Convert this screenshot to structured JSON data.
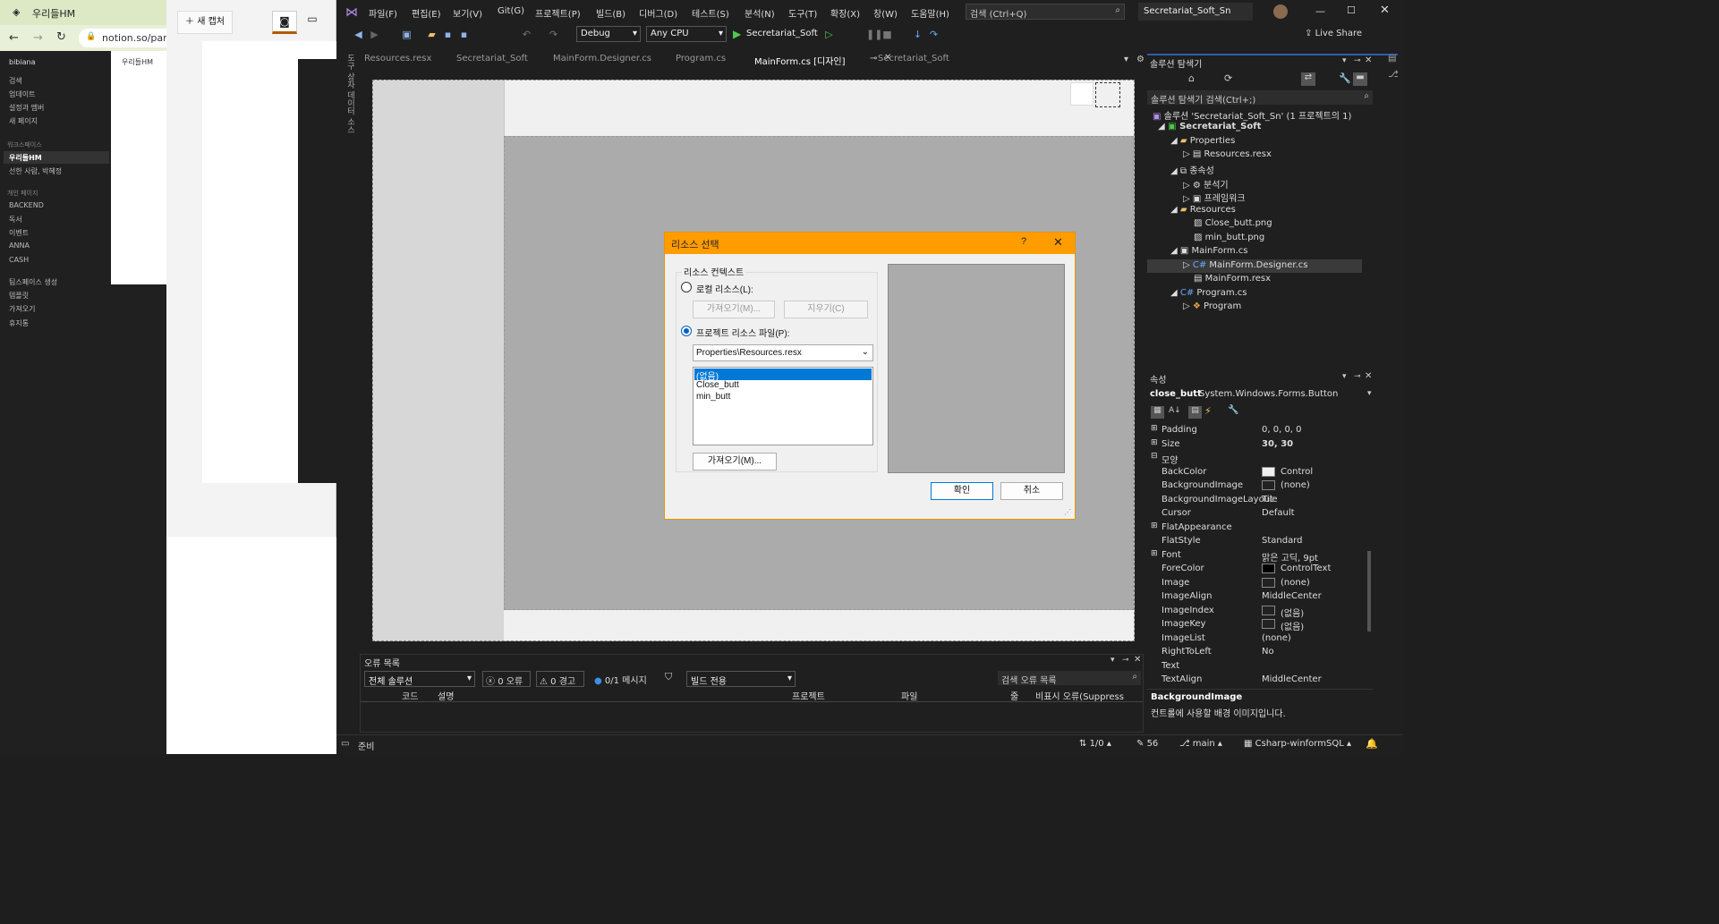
{
  "chrome": {
    "tab_title": "우리들HM",
    "address": "notion.so/par",
    "notion": {
      "workspace": "bibiana",
      "nav": [
        "검색",
        "업데이트",
        "설정과 멤버",
        "새 페이지"
      ],
      "section_workspace": "워크스페이스",
      "workspace_items": [
        "우리들HM",
        "선한 사람, 박혜정"
      ],
      "section_private": "개인 페이지",
      "private_items": [
        "BACKEND",
        "독서",
        "이벤트",
        "ANNA",
        "CASH"
      ],
      "bottom_items": [
        "팀스페이스 생성",
        "템플릿",
        "가져오기",
        "휴지통"
      ],
      "page_tab": "우리들HM"
    }
  },
  "capture": {
    "new_capture": "새 캡처"
  },
  "vs": {
    "menu": [
      "파일(F)",
      "편집(E)",
      "보기(V)",
      "Git(G)",
      "프로젝트(P)",
      "빌드(B)",
      "디버그(D)",
      "테스트(S)",
      "분석(N)",
      "도구(T)",
      "확장(X)",
      "창(W)",
      "도움말(H)"
    ],
    "search_placeholder": "검색 (Ctrl+Q)",
    "solution_name": "Secretariat_Soft_Sn",
    "live_share": "Live Share",
    "config": "Debug",
    "platform": "Any CPU",
    "run_target": "Secretariat_Soft",
    "doc_tabs": [
      "Resources.resx",
      "Secretariat_Soft",
      "MainForm.Designer.cs",
      "Program.cs",
      "MainForm.cs [디자인]",
      "Secretariat_Soft"
    ],
    "side_toolbox": "도구 상자  데이터 소스",
    "dialog": {
      "title": "리소스 선택",
      "help": "?",
      "group_label": "리소스 컨텍스트",
      "local_radio": "로컬 리소스(L):",
      "import_btn_disabled": "가져오기(M)...",
      "clear_btn": "지우기(C)",
      "project_radio": "프로젝트 리소스 파일(P):",
      "resx_file": "Properties\\Resources.resx",
      "list": [
        "(없음)",
        "Close_butt",
        "min_butt"
      ],
      "import_btn": "가져오기(M)...",
      "ok": "확인",
      "cancel": "취소"
    },
    "error_list": {
      "title": "오류 목록",
      "scope": "전체 솔루션",
      "errors": "0 오류",
      "warnings": "0 경고",
      "messages": "0/1 메시지",
      "build_filter": "빌드 전용",
      "search": "검색 오류 목록",
      "columns": [
        "코드",
        "설명",
        "프로젝트",
        "파일",
        "줄",
        "비표시 오류(Suppress"
      ]
    },
    "solution_explorer": {
      "title": "솔루션 탐색기",
      "search": "솔루션 탐색기 검색(Ctrl+;)",
      "items": [
        "솔루션 'Secretariat_Soft_Sn' (1 프로젝트의 1)",
        "Secretariat_Soft",
        "Properties",
        "Resources.resx",
        "종속성",
        "분석기",
        "프레임워크",
        "Resources",
        "Close_butt.png",
        "min_butt.png",
        "MainForm.cs",
        "MainForm.Designer.cs",
        "MainForm.resx",
        "Program.cs",
        "Program"
      ]
    },
    "properties": {
      "title": "속성",
      "object": "close_butt",
      "object_type": "System.Windows.Forms.Button",
      "rows": [
        {
          "name": "Padding",
          "value": "0, 0, 0, 0"
        },
        {
          "name": "Size",
          "value": "30, 30"
        },
        {
          "name": "모양",
          "value": ""
        },
        {
          "name": "BackColor",
          "value": "Control"
        },
        {
          "name": "BackgroundImage",
          "value": "(none)"
        },
        {
          "name": "BackgroundImageLayout",
          "value": "Tile"
        },
        {
          "name": "Cursor",
          "value": "Default"
        },
        {
          "name": "FlatAppearance",
          "value": ""
        },
        {
          "name": "FlatStyle",
          "value": "Standard"
        },
        {
          "name": "Font",
          "value": "맑은 고딕, 9pt"
        },
        {
          "name": "ForeColor",
          "value": "ControlText"
        },
        {
          "name": "Image",
          "value": "(none)"
        },
        {
          "name": "ImageAlign",
          "value": "MiddleCenter"
        },
        {
          "name": "ImageIndex",
          "value": "(없음)"
        },
        {
          "name": "ImageKey",
          "value": "(없음)"
        },
        {
          "name": "ImageList",
          "value": "(none)"
        },
        {
          "name": "RightToLeft",
          "value": "No"
        },
        {
          "name": "Text",
          "value": ""
        },
        {
          "name": "TextAlign",
          "value": "MiddleCenter"
        }
      ],
      "desc_title": "BackgroundImage",
      "desc_text": "컨트롤에 사용할 배경 이미지입니다."
    },
    "status": {
      "ready": "준비",
      "lines": "1/0",
      "edits": "56",
      "branch": "main",
      "repo": "Csharp-winformSQL"
    }
  }
}
